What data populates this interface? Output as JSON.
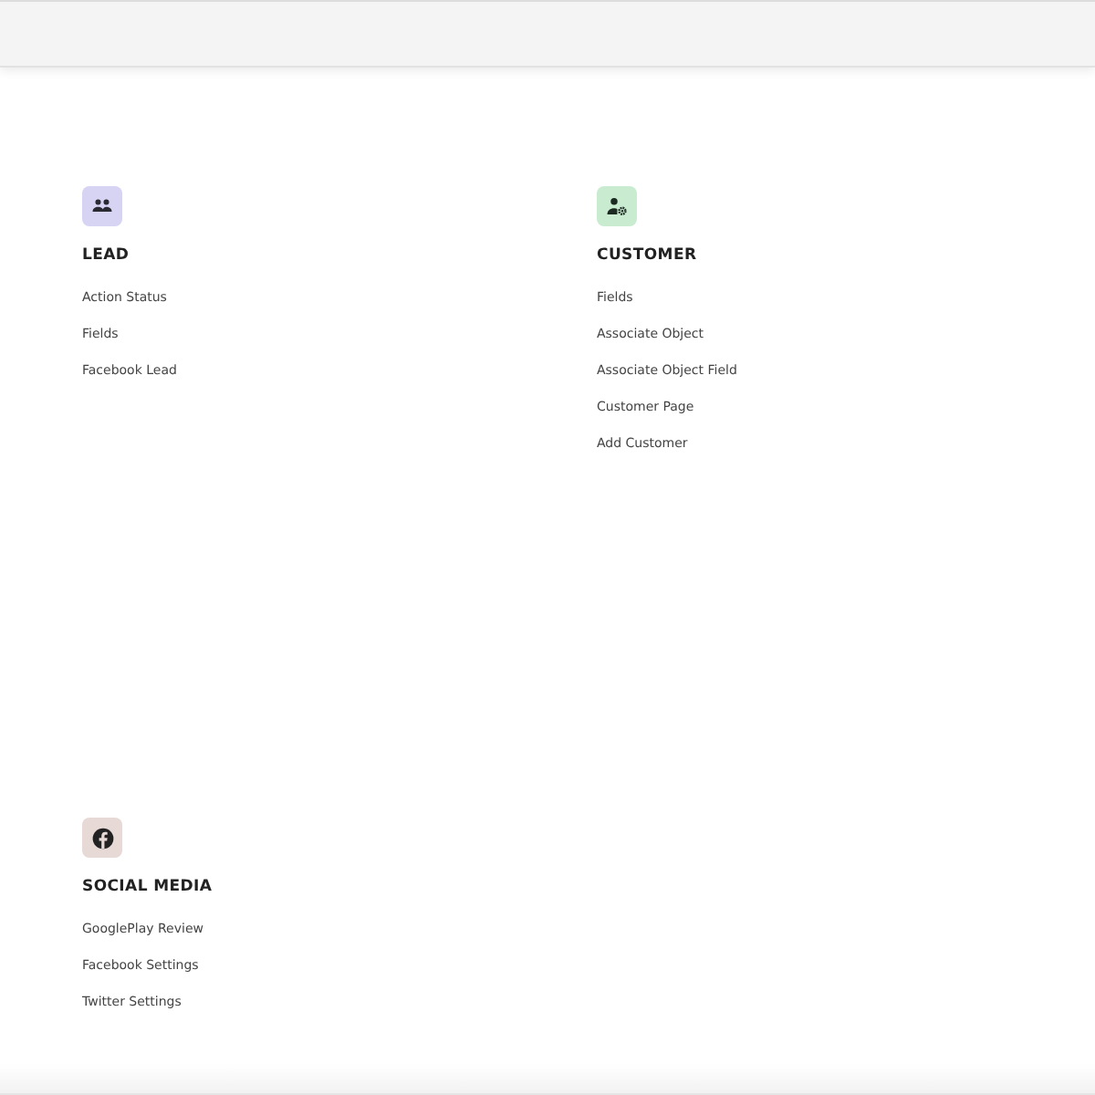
{
  "sections": [
    {
      "title": "LEAD",
      "kind": "people",
      "color": "#d6d3f3",
      "items": [
        "Action Status",
        "Fields",
        "Facebook Lead"
      ]
    },
    {
      "title": "CUSTOMER",
      "kind": "user-gear",
      "color": "#c9ecd1",
      "items": [
        "Fields",
        "Associate Object",
        "Associate Object Field",
        "Customer Page",
        "Add Customer"
      ]
    },
    {
      "title": "SOCIAL MEDIA",
      "kind": "facebook",
      "color": "#e7d9d5",
      "items": [
        "GooglePlay Review",
        "Facebook Settings",
        "Twitter Settings"
      ]
    }
  ]
}
